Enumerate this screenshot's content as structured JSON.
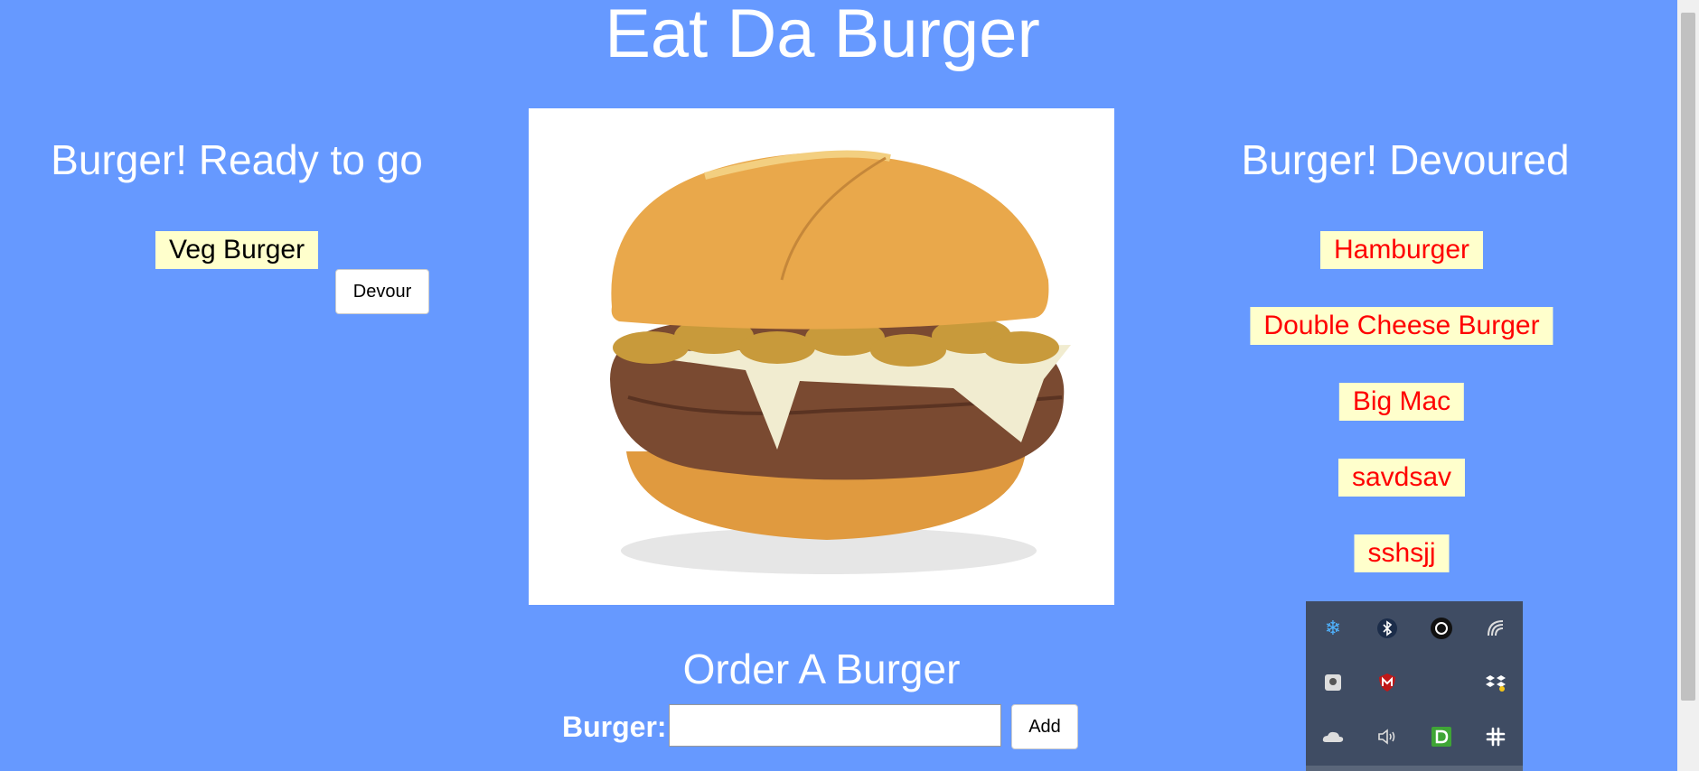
{
  "page": {
    "title": "Eat Da Burger"
  },
  "ready": {
    "heading": "Burger! Ready to go",
    "items": [
      {
        "name": "Veg Burger",
        "button": "Devour"
      }
    ]
  },
  "devoured": {
    "heading": "Burger! Devoured",
    "items": [
      "Hamburger",
      "Double Cheese Burger",
      "Big Mac",
      "savdsav",
      "sshsjj"
    ]
  },
  "order": {
    "heading": "Order A Burger",
    "label": "Burger:",
    "input_value": "",
    "button": "Add"
  },
  "tray": {
    "icons": [
      "snowflake-icon",
      "bluetooth-icon",
      "beats-audio-icon",
      "wifi-icon",
      "hard-drive-icon",
      "mcafee-icon",
      "dropbox-icon",
      "onedrive-icon",
      "volume-icon",
      "dashlane-icon",
      "slack-icon"
    ]
  },
  "colors": {
    "background": "#6699ff",
    "pill": "#ffffcc",
    "devoured_text": "#ff0000"
  }
}
